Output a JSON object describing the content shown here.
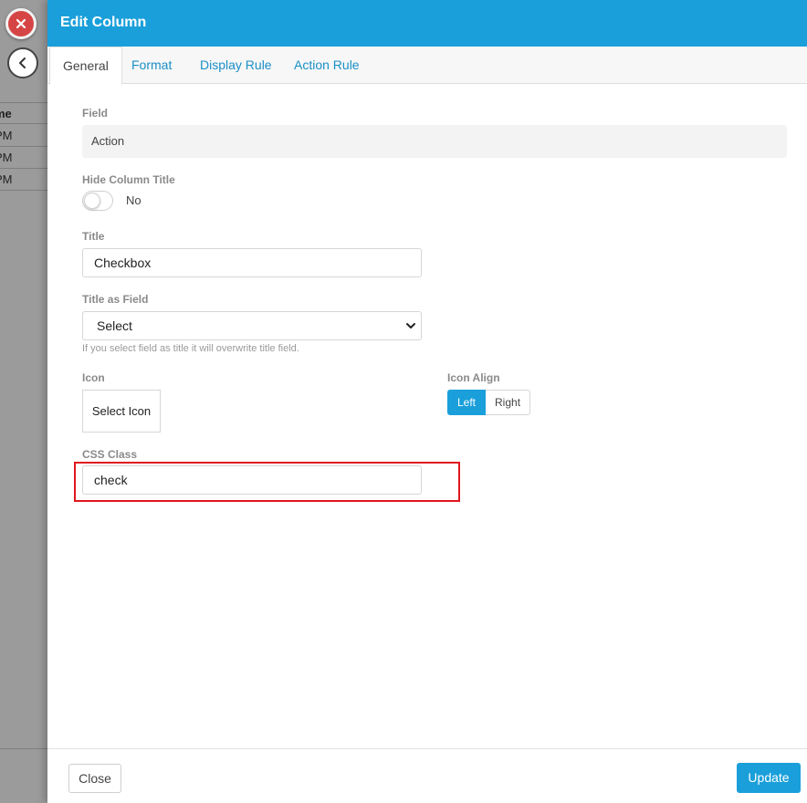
{
  "background": {
    "column_header": "me",
    "rows": [
      "PM",
      "PM",
      "PM"
    ]
  },
  "modal": {
    "title": "Edit Column",
    "tabs": [
      {
        "label": "General",
        "active": true
      },
      {
        "label": "Format",
        "active": false
      },
      {
        "label": "Display Rule",
        "active": false
      },
      {
        "label": "Action Rule",
        "active": false
      }
    ],
    "form": {
      "field": {
        "label": "Field",
        "value": "Action"
      },
      "hide_column_title": {
        "label": "Hide Column Title",
        "state_text": "No",
        "enabled": false
      },
      "title": {
        "label": "Title",
        "value": "Checkbox"
      },
      "title_as_field": {
        "label": "Title as Field",
        "selected": "Select",
        "help": "If you select field as title it will overwrite title field."
      },
      "icon": {
        "label": "Icon",
        "button_label": "Select Icon"
      },
      "icon_align": {
        "label": "Icon Align",
        "options": [
          "Left",
          "Right"
        ],
        "selected": "Left"
      },
      "css_class": {
        "label": "CSS Class",
        "value": "check"
      }
    },
    "footer": {
      "close_label": "Close",
      "update_label": "Update"
    }
  },
  "colors": {
    "accent": "#1a9fda",
    "highlight": "#e0161f",
    "danger": "#d64545"
  }
}
